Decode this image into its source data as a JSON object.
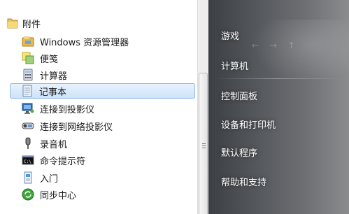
{
  "folder": {
    "icon": "folder-icon",
    "label": "附件"
  },
  "items": [
    {
      "label": "Windows 资源管理器",
      "icon": "explorer-icon"
    },
    {
      "label": "便笺",
      "icon": "sticky-notes-icon"
    },
    {
      "label": "计算器",
      "icon": "calculator-icon"
    },
    {
      "label": "记事本",
      "icon": "notepad-icon",
      "selected": true
    },
    {
      "label": "连接到投影仪",
      "icon": "projector-icon"
    },
    {
      "label": "连接到网络投影仪",
      "icon": "network-projector-icon"
    },
    {
      "label": "录音机",
      "icon": "microphone-icon"
    },
    {
      "label": "命令提示符",
      "icon": "command-prompt-icon"
    },
    {
      "label": "入门",
      "icon": "getting-started-icon"
    },
    {
      "label": "同步中心",
      "icon": "sync-center-icon"
    }
  ],
  "right_menu": [
    {
      "label": "游戏"
    },
    {
      "label": "计算机"
    },
    {
      "label": "控制面板"
    },
    {
      "label": "设备和打印机"
    },
    {
      "label": "默认程序"
    },
    {
      "label": "帮助和支持"
    }
  ],
  "colors": {
    "selection_bg": "#cde3f9",
    "selection_border": "#8fb8e6",
    "right_pane": "#55585c"
  }
}
